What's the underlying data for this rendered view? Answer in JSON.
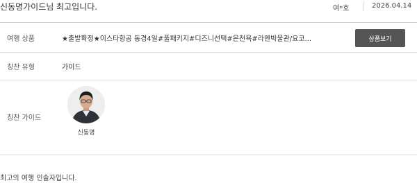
{
  "review": {
    "title": "신동명가이드님 최고입니다.",
    "author": "여*호",
    "date": "2026.04.14",
    "comment": "최고의 여행 인솔자입니다."
  },
  "product": {
    "label": "여행 상품",
    "value": "★출발확정★이스타항공 동경4일#풀패키지#디즈니선택#온천욕#라멘박물관/요코...",
    "button_label": "상품보기"
  },
  "praise_type": {
    "label": "칭찬 유형",
    "value": "가이드"
  },
  "praise_guide": {
    "label": "칭찬 가이드",
    "name": "신동명",
    "avatar_icon": "guide-portrait"
  }
}
